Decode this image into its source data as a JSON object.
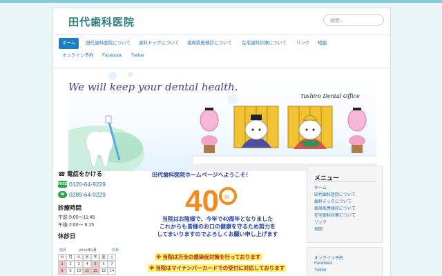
{
  "header": {
    "site_title": "田代歯科医院",
    "search_placeholder": "検索..."
  },
  "nav": {
    "items": [
      {
        "label": "ホーム",
        "active": true
      },
      {
        "label": "田代歯科医院について"
      },
      {
        "label": "歯科ドックについて"
      },
      {
        "label": "歯周疾患検診について"
      },
      {
        "label": "在宅歯科診療について"
      },
      {
        "label": "リンク"
      },
      {
        "label": "地図"
      },
      {
        "label": "オンライン予約"
      },
      {
        "label": "Facebook"
      },
      {
        "label": "Twitter"
      }
    ]
  },
  "banner": {
    "tagline": "We will keep your dental health.",
    "office_name": "Tashiro Dental Office"
  },
  "left": {
    "phone_heading": "☎ 電話をかける",
    "phone1": "0120-64-9229",
    "phone1_icon_text": "FREE",
    "phone2": "0289-64-9229",
    "hours_heading": "診療時間",
    "hours_am": "午前 9:00〜11:45",
    "hours_pm": "午後 2:00〜 6:15",
    "closed_heading": "休診日",
    "calendar": {
      "prev": "前月",
      "title": "2026年2月",
      "next": "次月",
      "weekdays": [
        "日",
        "月",
        "火",
        "水",
        "木",
        "金",
        "土"
      ],
      "row1": [
        "1",
        "2",
        "3",
        "4",
        "5",
        "6",
        "7"
      ],
      "row2": [
        "8",
        "9",
        "10",
        "11",
        "12",
        "13",
        "14"
      ]
    }
  },
  "center": {
    "welcome": "田代歯科医院ホームページへようこそ！",
    "anniversary_number": "40",
    "anniversary_suffix": "th",
    "message_line1": "当院はお陰様で、今年で40周年となりました",
    "message_line2": "これからも皆様のお口の健康を守るため努力を",
    "message_line3": "してまいりますのでよろしくお願い申し上げます",
    "notice1": "※ 当院は万全の感染症対策を行っております",
    "notice2": "※ 当院はマイナンバーカードでの受付に対応しております"
  },
  "sidebar": {
    "menu_title": "メニュー",
    "menu_items": [
      "ホーム",
      "田代歯科医院について",
      "歯科ドックについて",
      "歯周疾患検診について",
      "在宅歯科診療について",
      "リンク",
      "地図"
    ],
    "links": [
      "オンライン予約",
      "Facebook",
      "Twitter"
    ]
  },
  "colors": {
    "accent": "#1b7fc4",
    "title_green": "#2f7f7d",
    "text_blue": "#1f3fa5",
    "notice_red": "#c01b1b",
    "notice_yellow": "#fff36a",
    "anniversary_orange": "#f28c1c"
  }
}
